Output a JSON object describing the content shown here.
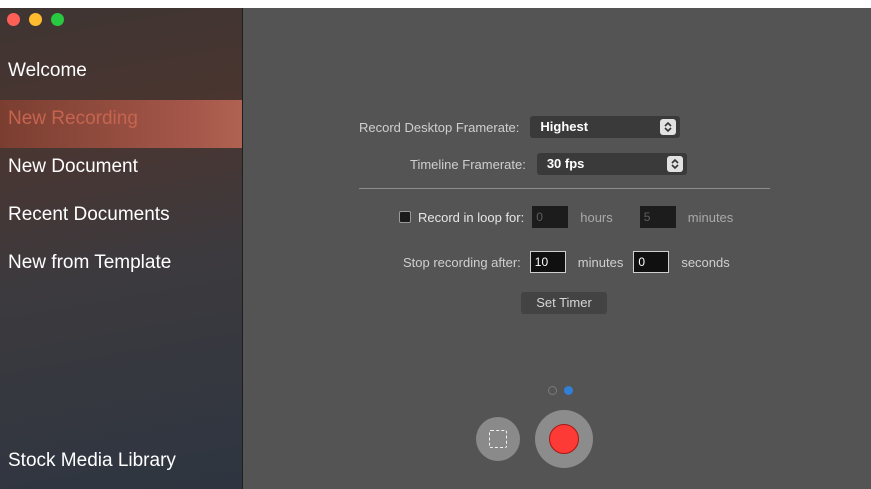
{
  "sidebar": {
    "items": [
      {
        "label": "Welcome"
      },
      {
        "label": "New Recording"
      },
      {
        "label": "New Document"
      },
      {
        "label": "Recent Documents"
      },
      {
        "label": "New from Template"
      }
    ],
    "bottom_label": "Stock Media Library"
  },
  "settings": {
    "desktop_framerate_label": "Record Desktop Framerate:",
    "desktop_framerate_value": "Highest",
    "timeline_framerate_label": "Timeline Framerate:",
    "timeline_framerate_value": "30 fps",
    "loop_label": "Record in loop for:",
    "loop_hours": "0",
    "hours_unit": "hours",
    "loop_minutes": "5",
    "minutes_unit": "minutes",
    "stop_label": "Stop recording after:",
    "stop_minutes": "10",
    "stop_minutes_unit": "minutes",
    "stop_seconds": "0",
    "stop_seconds_unit": "seconds",
    "set_timer_label": "Set Timer"
  },
  "colors": {
    "accent": "#c6644f",
    "record": "#fd3a35",
    "page_indicator_active": "#2f80d6"
  },
  "icons": {
    "popup_chevron": "up-down-chevron-icon",
    "select_area": "dashed-square-icon",
    "record": "record-icon"
  }
}
